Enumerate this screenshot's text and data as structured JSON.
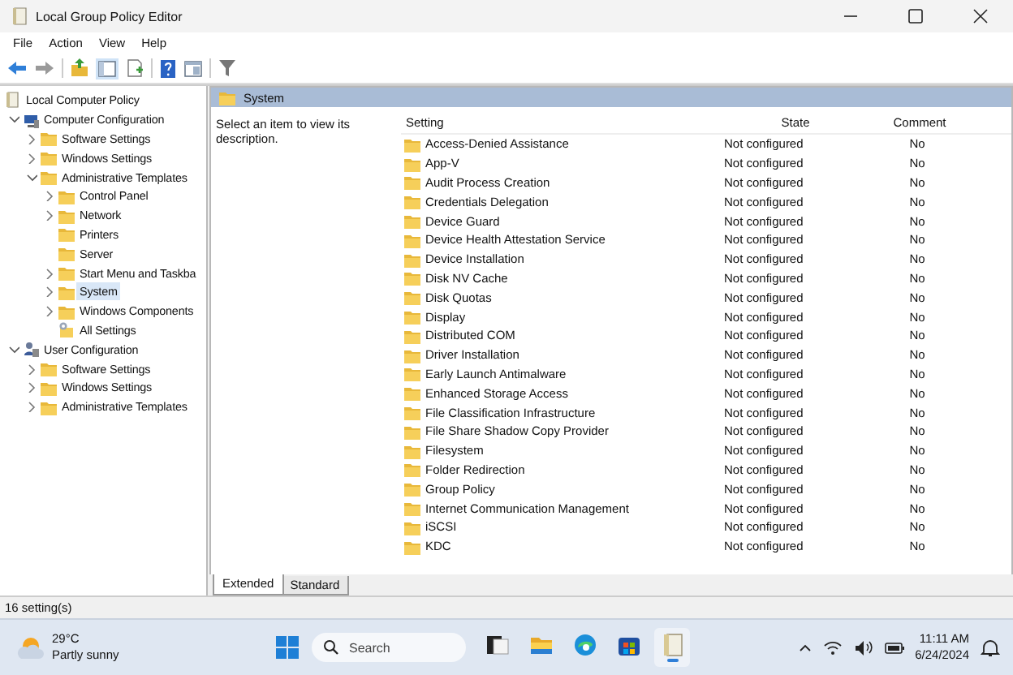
{
  "window": {
    "title": "Local Group Policy Editor"
  },
  "menu": [
    "File",
    "Action",
    "View",
    "Help"
  ],
  "tree": [
    {
      "label": "Local Computer Policy",
      "kind": "policy",
      "selected": false,
      "children": [
        {
          "label": "Computer Configuration",
          "kind": "computer",
          "selected": false,
          "expanded": true,
          "children": [
            {
              "label": "Software Settings",
              "kind": "folder",
              "selected": false,
              "expanded": false
            },
            {
              "label": "Windows Settings",
              "kind": "folder",
              "selected": false,
              "expanded": false
            },
            {
              "label": "Administrative Templates",
              "kind": "folder",
              "selected": false,
              "expanded": true,
              "children": [
                {
                  "label": "Control Panel",
                  "kind": "folder",
                  "selected": false,
                  "expanded": false
                },
                {
                  "label": "Network",
                  "kind": "folder",
                  "selected": false,
                  "expanded": false
                },
                {
                  "label": "Printers",
                  "kind": "folder",
                  "selected": false
                },
                {
                  "label": "Server",
                  "kind": "folder",
                  "selected": false
                },
                {
                  "label": "Start Menu and Taskba",
                  "kind": "folder",
                  "selected": false,
                  "expanded": false
                },
                {
                  "label": "System",
                  "kind": "folder",
                  "selected": true,
                  "expanded": false
                },
                {
                  "label": "Windows Components",
                  "kind": "folder",
                  "selected": false,
                  "expanded": false
                },
                {
                  "label": "All Settings",
                  "kind": "settings",
                  "selected": false
                }
              ]
            }
          ]
        },
        {
          "label": "User Configuration",
          "kind": "user",
          "selected": false,
          "expanded": true,
          "children": [
            {
              "label": "Software Settings",
              "kind": "folder",
              "selected": false,
              "expanded": false
            },
            {
              "label": "Windows Settings",
              "kind": "folder",
              "selected": false,
              "expanded": false
            },
            {
              "label": "Administrative Templates",
              "kind": "folder",
              "selected": false,
              "expanded": false
            }
          ]
        }
      ]
    }
  ],
  "details": {
    "header": "System",
    "description": "Select an item to view its description.",
    "columns": [
      "Setting",
      "State",
      "Comment"
    ],
    "rows": [
      {
        "setting": "Access-Denied Assistance",
        "state": "Not configured",
        "comment": "No"
      },
      {
        "setting": "App-V",
        "state": "Not configured",
        "comment": "No"
      },
      {
        "setting": "Audit Process Creation",
        "state": "Not configured",
        "comment": "No"
      },
      {
        "setting": "Credentials Delegation",
        "state": "Not configured",
        "comment": "No"
      },
      {
        "setting": "Device Guard",
        "state": "Not configured",
        "comment": "No"
      },
      {
        "setting": "Device Health Attestation Service",
        "state": "Not configured",
        "comment": "No"
      },
      {
        "setting": "Device Installation",
        "state": "Not configured",
        "comment": "No"
      },
      {
        "setting": "Disk NV Cache",
        "state": "Not configured",
        "comment": "No"
      },
      {
        "setting": "Disk Quotas",
        "state": "Not configured",
        "comment": "No"
      },
      {
        "setting": "Display",
        "state": "Not configured",
        "comment": "No"
      },
      {
        "setting": "Distributed COM",
        "state": "Not configured",
        "comment": "No"
      },
      {
        "setting": "Driver Installation",
        "state": "Not configured",
        "comment": "No"
      },
      {
        "setting": "Early Launch Antimalware",
        "state": "Not configured",
        "comment": "No"
      },
      {
        "setting": "Enhanced Storage Access",
        "state": "Not configured",
        "comment": "No"
      },
      {
        "setting": "File Classification Infrastructure",
        "state": "Not configured",
        "comment": "No"
      },
      {
        "setting": "File Share Shadow Copy Provider",
        "state": "Not configured",
        "comment": "No"
      },
      {
        "setting": "Filesystem",
        "state": "Not configured",
        "comment": "No"
      },
      {
        "setting": "Folder Redirection",
        "state": "Not configured",
        "comment": "No"
      },
      {
        "setting": "Group Policy",
        "state": "Not configured",
        "comment": "No"
      },
      {
        "setting": "Internet Communication Management",
        "state": "Not configured",
        "comment": "No"
      },
      {
        "setting": "iSCSI",
        "state": "Not configured",
        "comment": "No"
      },
      {
        "setting": "KDC",
        "state": "Not configured",
        "comment": "No"
      }
    ]
  },
  "tabs": [
    {
      "label": "Extended",
      "selected": true
    },
    {
      "label": "Standard",
      "selected": false
    }
  ],
  "status_bar": "16 setting(s)",
  "taskbar": {
    "temperature": "29°C",
    "weather": "Partly sunny",
    "search": {
      "placeholder": "Search"
    },
    "apps": [
      {
        "kind": "task-view",
        "selected": false
      },
      {
        "kind": "explorer",
        "selected": false
      },
      {
        "kind": "edge",
        "selected": false
      },
      {
        "kind": "store",
        "selected": false
      },
      {
        "kind": "gpedit",
        "selected": true
      }
    ],
    "time": "11:11 AM",
    "date": "6/24/2024"
  }
}
